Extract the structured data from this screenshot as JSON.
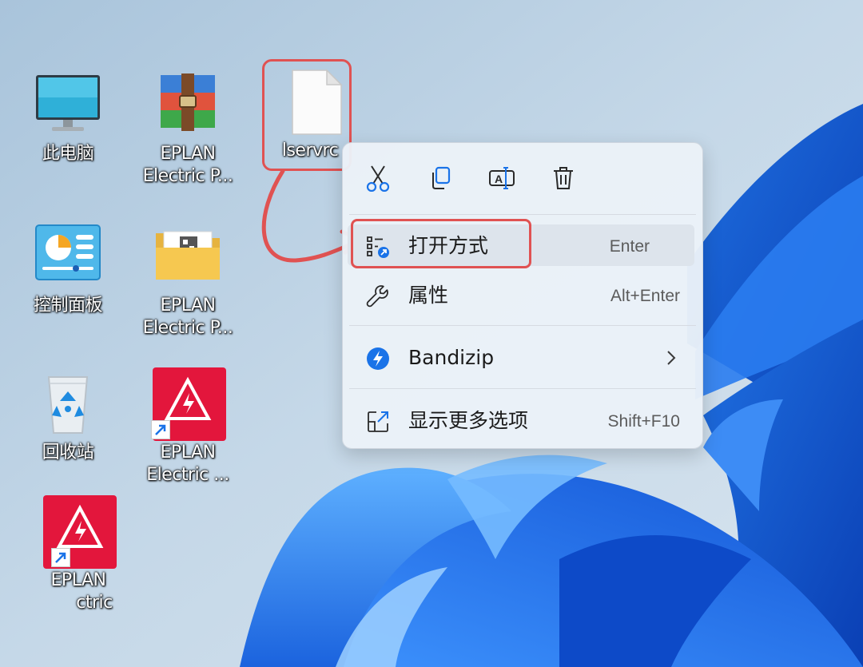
{
  "desktop": {
    "icons": [
      {
        "label": "此电脑",
        "icon": "monitor-icon"
      },
      {
        "label": "EPLAN Electric P...",
        "icon": "winrar-archive-icon"
      },
      {
        "label": "lservrc",
        "icon": "blank-file-icon"
      },
      {
        "label": "控制面板",
        "icon": "control-panel-icon"
      },
      {
        "label": "EPLAN Electric P...",
        "icon": "folder-icon"
      },
      {
        "label": "回收站",
        "icon": "recycle-bin-icon"
      },
      {
        "label": "EPLAN Electric ...",
        "icon": "eplan-shortcut-icon"
      },
      {
        "label": "EPLAN",
        "label2": "ctric",
        "icon": "eplan-shortcut-icon"
      }
    ],
    "label_lines": {
      "i1a": "EPLAN",
      "i1b": "Electric P...",
      "i4a": "EPLAN",
      "i4b": "Electric P...",
      "i6a": "EPLAN",
      "i6b": "Electric ...",
      "i7a": "EPLAN",
      "i7b": "ctric"
    }
  },
  "context_menu": {
    "toolbar": [
      {
        "name": "cut",
        "icon": "scissors-icon"
      },
      {
        "name": "copy",
        "icon": "copy-icon"
      },
      {
        "name": "rename",
        "icon": "rename-icon"
      },
      {
        "name": "delete",
        "icon": "trash-icon"
      }
    ],
    "items": [
      {
        "label": "打开方式",
        "shortcut": "Enter",
        "icon": "open-with-icon"
      },
      {
        "label": "属性",
        "shortcut": "Alt+Enter",
        "icon": "wrench-icon"
      },
      {
        "label": "Bandizip",
        "icon": "bandizip-icon",
        "has_submenu": true
      },
      {
        "label": "显示更多选项",
        "shortcut": "Shift+F10",
        "icon": "show-more-icon"
      }
    ]
  },
  "colors": {
    "accent_blue": "#1a73e8",
    "highlight_red": "#e05252",
    "eplan_red": "#e3163c"
  }
}
